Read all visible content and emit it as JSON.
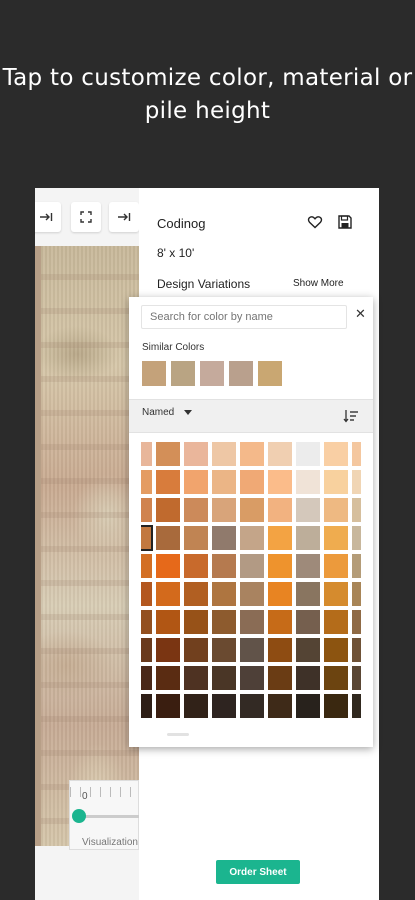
{
  "headline": "Tap to customize color, material or pile height",
  "toolbar": {
    "icons": [
      "move-right-icon",
      "fullscreen-icon",
      "move-right-icon"
    ]
  },
  "design": {
    "name": "Codinog",
    "size": "8' x 10'",
    "variations_label": "Design Variations",
    "show_more": "Show More"
  },
  "slider": {
    "value_label": "0",
    "caption": "Visualization",
    "value": 0
  },
  "order_button": "Order Sheet",
  "picker": {
    "search_placeholder": "Search for color by name",
    "close": "✕",
    "similar_title": "Similar Colors",
    "similar_colors": [
      "#c4a27a",
      "#b9a483",
      "#c5aa9c",
      "#b9a08d",
      "#c9a772"
    ],
    "filter_label": "Named",
    "selected_index": 27,
    "grid_colors": [
      "#e8b69a",
      "#d38f58",
      "#eab69b",
      "#eec7a5",
      "#f4b98a",
      "#f0cfb1",
      "#ececec",
      "#f9cfa4",
      "#f4c79f",
      "#e49c62",
      "#d87c3c",
      "#f1a46d",
      "#ebb586",
      "#f0a975",
      "#fbbc8a",
      "#f0e3d7",
      "#f8d19e",
      "#f0d5b4",
      "#d0834e",
      "#c06a2e",
      "#cc8a5a",
      "#d8a47a",
      "#d99c65",
      "#f2b280",
      "#d4c8bb",
      "#eeb982",
      "#d6bf9d",
      "#c2783f",
      "#a86a3c",
      "#c08453",
      "#907a6c",
      "#c4a589",
      "#f3a343",
      "#bdae9a",
      "#efac4f",
      "#c8b79c",
      "#d36f24",
      "#e6691a",
      "#c86a2c",
      "#b57a4f",
      "#b29a84",
      "#ee932d",
      "#9e8a7a",
      "#ec9a3c",
      "#b49c78",
      "#b3571f",
      "#d36a1c",
      "#b15f22",
      "#ae7540",
      "#a98360",
      "#e88422",
      "#897560",
      "#d58b2e",
      "#a88557",
      "#93501f",
      "#b15614",
      "#975218",
      "#8d5b2e",
      "#8a6c55",
      "#c66b18",
      "#755f4e",
      "#b46c1a",
      "#8f6a45",
      "#6a3a1c",
      "#7a3512",
      "#71401e",
      "#6a4a30",
      "#615349",
      "#8e4c12",
      "#544434",
      "#8c5410",
      "#6f5237",
      "#4a2818",
      "#5a2c12",
      "#4e3222",
      "#4a3626",
      "#4e4038",
      "#6a3c14",
      "#3e3128",
      "#6c4410",
      "#5a4634",
      "#2e1e16",
      "#3a1e10",
      "#312218",
      "#2e2420",
      "#332a24",
      "#3e2a18",
      "#28221c",
      "#3a2810",
      "#30281e"
    ]
  }
}
